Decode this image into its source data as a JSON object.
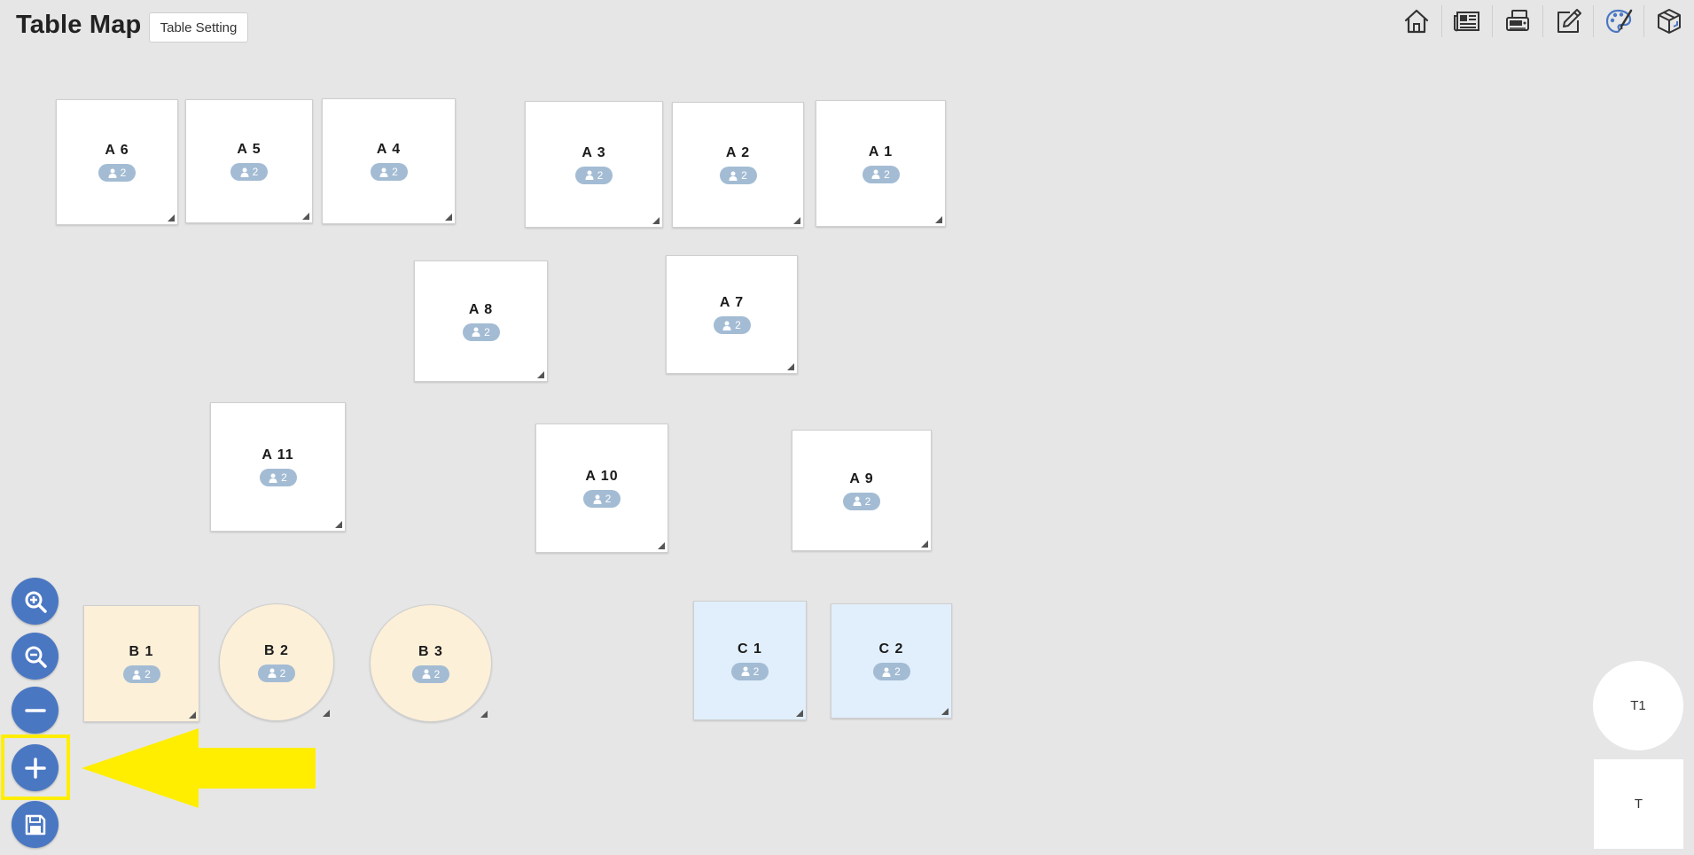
{
  "header": {
    "title": "Table Map",
    "setting_label": "Table Setting"
  },
  "toolbar": {
    "icons": [
      "home-icon",
      "news-icon",
      "register-icon",
      "edit-icon",
      "palette-icon",
      "box-icon"
    ],
    "accent": "#4a77c2"
  },
  "tables": [
    {
      "name": "A 6",
      "seats": "2"
    },
    {
      "name": "A 5",
      "seats": "2"
    },
    {
      "name": "A 4",
      "seats": "2"
    },
    {
      "name": "A 3",
      "seats": "2"
    },
    {
      "name": "A 2",
      "seats": "2"
    },
    {
      "name": "A 1",
      "seats": "2"
    },
    {
      "name": "A 8",
      "seats": "2"
    },
    {
      "name": "A 7",
      "seats": "2"
    },
    {
      "name": "A 11",
      "seats": "2"
    },
    {
      "name": "A 10",
      "seats": "2"
    },
    {
      "name": "A 9",
      "seats": "2"
    },
    {
      "name": "B 1",
      "seats": "2"
    },
    {
      "name": "B 2",
      "seats": "2"
    },
    {
      "name": "B 3",
      "seats": "2"
    },
    {
      "name": "C 1",
      "seats": "2"
    },
    {
      "name": "C 2",
      "seats": "2"
    }
  ],
  "colors": {
    "background": "#e6e6e6",
    "table_default": "#ffffff",
    "table_b": "#fdf0d8",
    "table_c": "#e1effc",
    "seat_badge": "#a3bcd4",
    "button": "#4a77c2",
    "highlight": "#ffee00"
  },
  "side_controls": {
    "icons": [
      "zoom-in-icon",
      "zoom-out-icon",
      "minus-icon",
      "plus-icon",
      "save-icon"
    ]
  },
  "misc_tables": {
    "t1_label": "T1",
    "t_label": "T"
  }
}
